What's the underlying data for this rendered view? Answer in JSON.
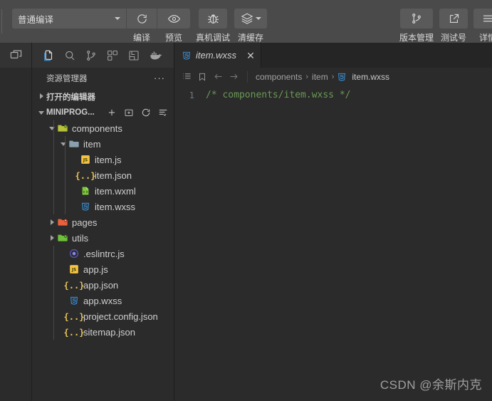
{
  "toolbar": {
    "compile_mode": {
      "value": "普通编译",
      "icon": "chevron-down-icon"
    },
    "buttons": [
      {
        "id": "compile",
        "label": "编译",
        "icon": "refresh-icon"
      },
      {
        "id": "preview",
        "label": "预览",
        "icon": "eye-icon"
      },
      {
        "id": "real-device-debug",
        "label": "真机调试",
        "icon": "bug-icon"
      },
      {
        "id": "clear-cache",
        "label": "清缓存",
        "icon": "layers-icon"
      }
    ],
    "right_buttons": [
      {
        "id": "version-control",
        "label": "版本管理",
        "icon": "git-branch-icon"
      },
      {
        "id": "test-account",
        "label": "测试号",
        "icon": "external-link-icon"
      },
      {
        "id": "details",
        "label": "详情",
        "icon": "menu-icon"
      }
    ]
  },
  "activitybar": {
    "rail_icon": "window-panel-icon",
    "items": [
      {
        "id": "explorer",
        "icon": "files-icon",
        "active": true
      },
      {
        "id": "search",
        "icon": "search-icon",
        "active": false
      },
      {
        "id": "source-control",
        "icon": "git-branch-icon",
        "active": false
      },
      {
        "id": "extensions",
        "icon": "extensions-icon",
        "active": false
      },
      {
        "id": "cloud",
        "icon": "cloud-save-icon",
        "active": false
      },
      {
        "id": "docker",
        "icon": "docker-icon",
        "active": false
      }
    ]
  },
  "sidebar": {
    "title": "资源管理器",
    "more_label": "···",
    "sections": [
      {
        "id": "open-editors",
        "label": "打开的编辑器",
        "expanded": false
      },
      {
        "id": "project",
        "label": "MINIPROG...",
        "expanded": true
      }
    ],
    "section_actions": [
      {
        "id": "new-file",
        "icon": "new-file-icon"
      },
      {
        "id": "new-folder",
        "icon": "new-folder-icon"
      },
      {
        "id": "refresh",
        "icon": "refresh-icon"
      },
      {
        "id": "collapse-all",
        "icon": "collapse-all-icon"
      }
    ],
    "tree": [
      {
        "name": "components",
        "type": "folder",
        "icon": "folder-components-icon",
        "depth": 1,
        "expanded": true
      },
      {
        "name": "item",
        "type": "folder",
        "icon": "folder-icon",
        "depth": 2,
        "expanded": true
      },
      {
        "name": "item.js",
        "type": "file",
        "icon": "js-icon",
        "depth": 3
      },
      {
        "name": "item.json",
        "type": "file",
        "icon": "json-icon",
        "depth": 3
      },
      {
        "name": "item.wxml",
        "type": "file",
        "icon": "wxml-icon",
        "depth": 3
      },
      {
        "name": "item.wxss",
        "type": "file",
        "icon": "wxss-icon",
        "depth": 3
      },
      {
        "name": "pages",
        "type": "folder",
        "icon": "folder-pages-icon",
        "depth": 1,
        "expanded": false
      },
      {
        "name": "utils",
        "type": "folder",
        "icon": "folder-utils-icon",
        "depth": 1,
        "expanded": false
      },
      {
        "name": ".eslintrc.js",
        "type": "file",
        "icon": "eslint-icon",
        "depth": 2
      },
      {
        "name": "app.js",
        "type": "file",
        "icon": "js-icon",
        "depth": 2
      },
      {
        "name": "app.json",
        "type": "file",
        "icon": "json-icon",
        "depth": 2
      },
      {
        "name": "app.wxss",
        "type": "file",
        "icon": "wxss-icon",
        "depth": 2
      },
      {
        "name": "project.config.json",
        "type": "file",
        "icon": "json-icon",
        "depth": 2
      },
      {
        "name": "sitemap.json",
        "type": "file",
        "icon": "json-icon",
        "depth": 2
      }
    ]
  },
  "editor": {
    "tab": {
      "label": "item.wxss",
      "icon": "wxss-icon",
      "close": "✕",
      "preview": true
    },
    "breadcrumb_icons": [
      {
        "id": "outline",
        "icon": "list-icon"
      },
      {
        "id": "bookmark",
        "icon": "bookmark-icon"
      },
      {
        "id": "back",
        "icon": "arrow-left-icon"
      },
      {
        "id": "forward",
        "icon": "arrow-right-icon"
      }
    ],
    "breadcrumb": [
      "components",
      "item"
    ],
    "breadcrumb_file": "item.wxss",
    "breadcrumb_file_icon": "wxss-icon",
    "lines": [
      {
        "number": "1",
        "text": "/* components/item.wxss */"
      }
    ]
  },
  "watermark": "CSDN @余斯内克",
  "colors": {
    "toolbar_bg": "#4a4a4a",
    "button_bg": "#5a5a5a",
    "editor_bg": "#2b2b2b",
    "sidebar_bg": "#2b2b2b",
    "tabbar_bg": "#252526",
    "accent_blue": "#3c9ae8",
    "comment_green": "#6a9955",
    "js_yellow": "#f5c344",
    "json_yellow": "#e8c35a"
  }
}
